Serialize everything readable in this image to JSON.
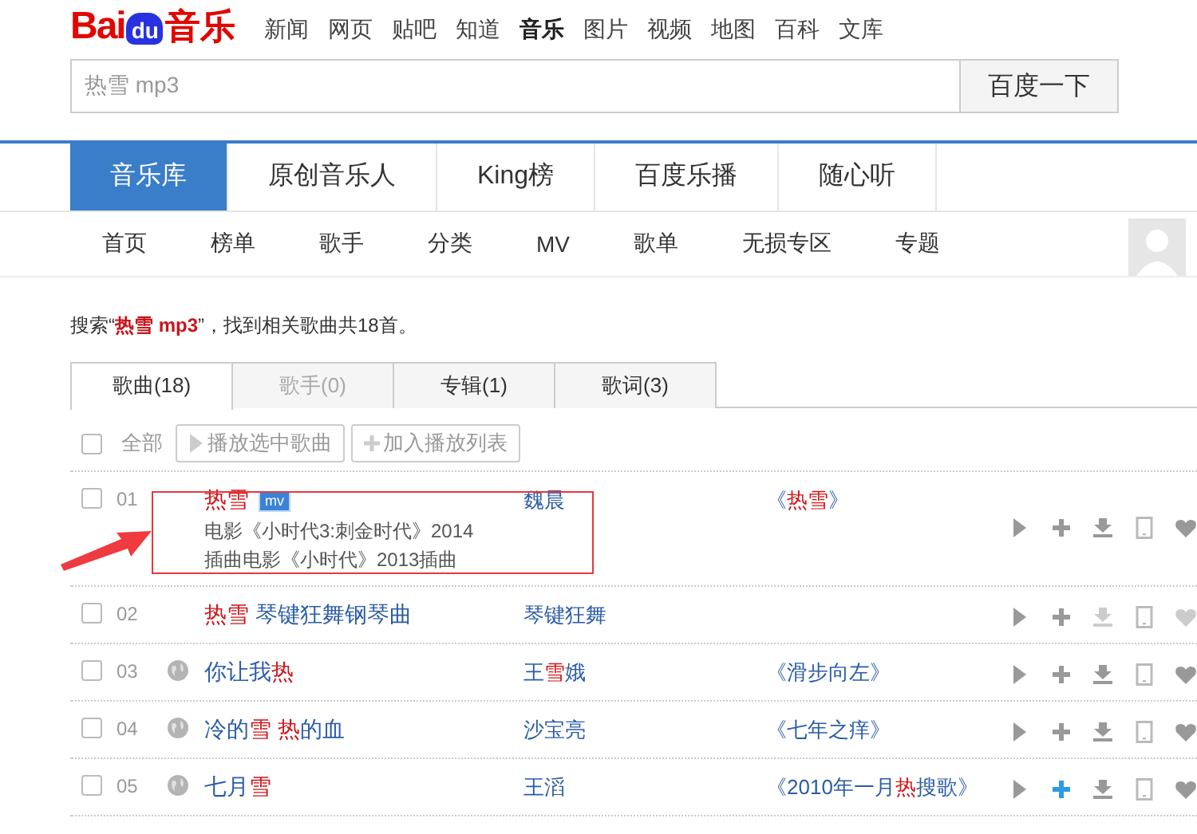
{
  "logo": {
    "left": "Bai",
    "badge": "du",
    "right": "音乐"
  },
  "top_nav": [
    {
      "label": "新闻",
      "selected": false
    },
    {
      "label": "网页",
      "selected": false
    },
    {
      "label": "贴吧",
      "selected": false
    },
    {
      "label": "知道",
      "selected": false
    },
    {
      "label": "音乐",
      "selected": true
    },
    {
      "label": "图片",
      "selected": false
    },
    {
      "label": "视频",
      "selected": false
    },
    {
      "label": "地图",
      "selected": false
    },
    {
      "label": "百科",
      "selected": false
    },
    {
      "label": "文库",
      "selected": false
    }
  ],
  "search": {
    "value": "热雪 mp3",
    "button": "百度一下"
  },
  "main_tabs": [
    {
      "label": "音乐库",
      "selected": true
    },
    {
      "label": "原创音乐人",
      "selected": false
    },
    {
      "label": "King榜",
      "selected": false
    },
    {
      "label": "百度乐播",
      "selected": false
    },
    {
      "label": "随心听",
      "selected": false
    }
  ],
  "sub_nav": [
    "首页",
    "榜单",
    "歌手",
    "分类",
    "MV",
    "歌单",
    "无损专区",
    "专题"
  ],
  "result_summary": "搜索“**热雪 mp3**”，找到相关歌曲共18首。",
  "result_tabs": [
    {
      "label": "歌曲(18)",
      "selected": true,
      "disabled": false
    },
    {
      "label": "歌手(0)",
      "selected": false,
      "disabled": true
    },
    {
      "label": "专辑(1)",
      "selected": false,
      "disabled": false
    },
    {
      "label": "歌词(3)",
      "selected": false,
      "disabled": false
    }
  ],
  "toolbar": {
    "select_all": {
      "label": "全部",
      "checked": false
    },
    "buttons": [
      {
        "label": "播放选中歌曲",
        "kind": "play"
      },
      {
        "label": "加入播放列表",
        "kind": "add"
      }
    ]
  },
  "songs": [
    {
      "number": "01",
      "checked": false,
      "web": false,
      "title": "**热雪**",
      "badge": "mv",
      "details": [
        "电影《小时代3:刺金时代》2014",
        "插曲电影《小时代》2013插曲"
      ],
      "artist": "魏晨",
      "album": "《**热雪**》",
      "downloadable": true,
      "favoritable": true,
      "add_hover": false
    },
    {
      "number": "02",
      "checked": false,
      "web": false,
      "title": "**热雪** 琴键狂舞钢琴曲",
      "artist": "琴键狂舞",
      "downloadable": false,
      "favoritable": false,
      "add_hover": false
    },
    {
      "number": "03",
      "checked": false,
      "web": true,
      "title": "你让我**热**",
      "artist": "王**雪**娥",
      "album": "《滑步向左》",
      "downloadable": true,
      "favoritable": true,
      "add_hover": false
    },
    {
      "number": "04",
      "checked": false,
      "web": true,
      "title": "冷的**雪** **热**的血",
      "artist": "沙宝亮",
      "album": "《七年之痒》",
      "downloadable": true,
      "favoritable": true,
      "add_hover": false
    },
    {
      "number": "05",
      "checked": false,
      "web": true,
      "title": "七月**雪**",
      "artist": "王滔",
      "album": "《2010年一月**热**搜歌》",
      "downloadable": true,
      "favoritable": true,
      "add_hover": true
    }
  ]
}
